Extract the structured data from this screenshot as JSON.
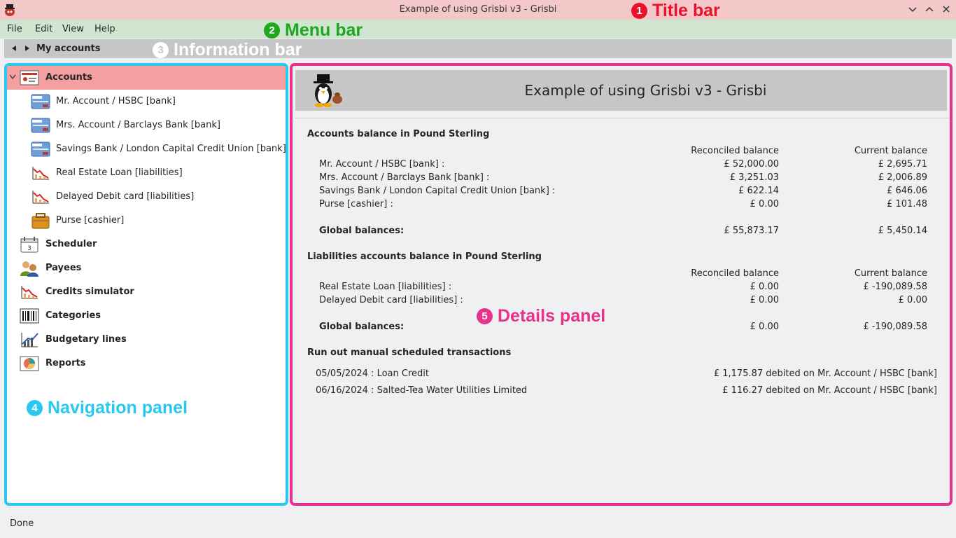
{
  "window": {
    "title": "Example of using Grisbi v3 - Grisbi",
    "controls": [
      "minimize-icon",
      "maximize-icon",
      "close-icon"
    ]
  },
  "menu": [
    "File",
    "Edit",
    "View",
    "Help"
  ],
  "infobar": {
    "title": "My accounts"
  },
  "annotations": [
    {
      "num": "1",
      "label": "Title bar",
      "color": "#e8132b"
    },
    {
      "num": "2",
      "label": "Menu bar",
      "color": "#1fa71f"
    },
    {
      "num": "3",
      "label": "Information bar",
      "color": "#ffffff"
    },
    {
      "num": "4",
      "label": "Navigation panel",
      "color": "#29c8ef"
    },
    {
      "num": "5",
      "label": "Details panel",
      "color": "#e6328a"
    }
  ],
  "navigation": {
    "items": [
      {
        "label": "Accounts",
        "icon": "accounts-icon",
        "level": 0,
        "selected": true
      },
      {
        "label": "Mr. Account / HSBC [bank]",
        "icon": "bank-card-icon",
        "level": 1
      },
      {
        "label": "Mrs. Account / Barclays Bank [bank]",
        "icon": "bank-card-icon",
        "level": 1
      },
      {
        "label": "Savings Bank  / London Capital Credit Union [bank]",
        "icon": "bank-card-icon",
        "level": 1
      },
      {
        "label": "Real Estate Loan [liabilities]",
        "icon": "liability-chart-icon",
        "level": 1
      },
      {
        "label": "Delayed Debit card [liabilities]",
        "icon": "liability-chart-icon",
        "level": 1
      },
      {
        "label": "Purse [cashier]",
        "icon": "purse-icon",
        "level": 1
      },
      {
        "label": "Scheduler",
        "icon": "calendar-icon",
        "level": 0
      },
      {
        "label": "Payees",
        "icon": "payees-icon",
        "level": 0
      },
      {
        "label": "Credits simulator",
        "icon": "credits-chart-icon",
        "level": 0
      },
      {
        "label": "Categories",
        "icon": "barcode-icon",
        "level": 0
      },
      {
        "label": "Budgetary lines",
        "icon": "budget-chart-icon",
        "level": 0
      },
      {
        "label": "Reports",
        "icon": "reports-icon",
        "level": 0
      }
    ]
  },
  "details": {
    "title": "Example of using Grisbi v3 - Grisbi",
    "accounts": {
      "heading": "Accounts balance in Pound Sterling",
      "col_reconciled": "Reconciled balance",
      "col_current": "Current balance",
      "rows": [
        {
          "label": "Mr. Account / HSBC [bank] :",
          "reconciled": "£ 52,000.00",
          "current": "£ 2,695.71"
        },
        {
          "label": "Mrs. Account / Barclays Bank [bank] :",
          "reconciled": "£ 3,251.03",
          "current": "£ 2,006.89"
        },
        {
          "label": "Savings Bank  / London Capital Credit Union [bank] :",
          "reconciled": "£ 622.14",
          "current": "£ 646.06"
        },
        {
          "label": "Purse [cashier] :",
          "reconciled": "£ 0.00",
          "current": "£ 101.48"
        }
      ],
      "global_label": "Global balances:",
      "global_reconciled": "£ 55,873.17",
      "global_current": "£ 5,450.14"
    },
    "liabilities": {
      "heading": "Liabilities accounts balance in Pound Sterling",
      "col_reconciled": "Reconciled balance",
      "col_current": "Current balance",
      "rows": [
        {
          "label": "Real Estate Loan [liabilities] :",
          "reconciled": "£ 0.00",
          "current": "£ -190,089.58"
        },
        {
          "label": "Delayed Debit card [liabilities] :",
          "reconciled": "£ 0.00",
          "current": "£ 0.00"
        }
      ],
      "global_label": "Global balances:",
      "global_reconciled": "£ 0.00",
      "global_current": "£ -190,089.58"
    },
    "scheduled": {
      "heading": "Run out manual scheduled transactions",
      "rows": [
        {
          "label": "05/05/2024 : Loan Credit",
          "amount": "£ 1,175.87 debited on Mr. Account / HSBC [bank]"
        },
        {
          "label": "06/16/2024 : Salted-Tea Water Utilities Limited",
          "amount": "£ 116.27 debited on Mr. Account / HSBC [bank]"
        }
      ]
    }
  },
  "status": "Done"
}
